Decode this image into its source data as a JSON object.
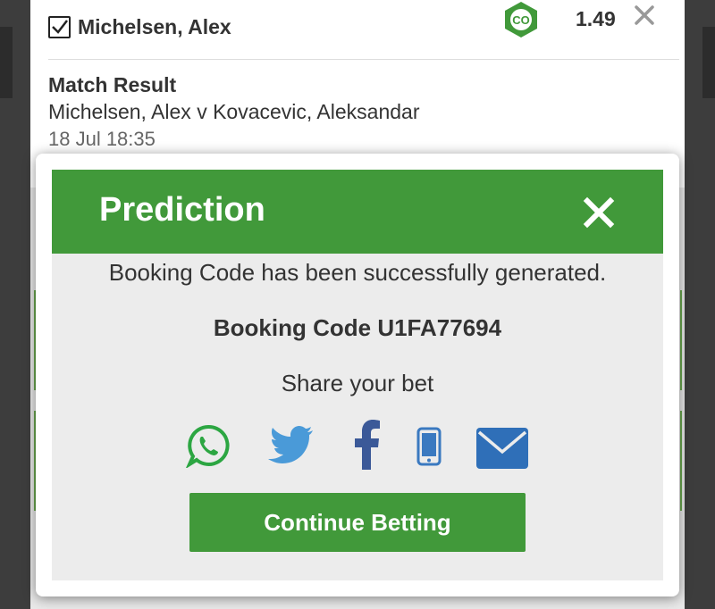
{
  "bet": {
    "selection": "Michelsen, Alex",
    "checked": true,
    "odds": "1.49",
    "market": "Match Result",
    "event": "Michelsen, Alex v Kovacevic, Aleksandar",
    "time": "18 Jul 18:35",
    "badge_icon": "co-badge-icon",
    "remove_icon": "close-icon"
  },
  "modal": {
    "title": "Prediction",
    "message": "Booking Code has been successfully generated.",
    "booking_code": "Booking Code U1FA77694",
    "share_label": "Share your bet",
    "share_icons": [
      "whatsapp-icon",
      "twitter-icon",
      "facebook-icon",
      "sms-icon",
      "email-icon"
    ],
    "continue_label": "Continue Betting"
  },
  "colors": {
    "brand_green": "#41993a",
    "whatsapp": "#2ca642",
    "twitter": "#4a9ad8",
    "facebook": "#3b5998",
    "sms": "#3a79c0",
    "email": "#2f6fb8"
  }
}
